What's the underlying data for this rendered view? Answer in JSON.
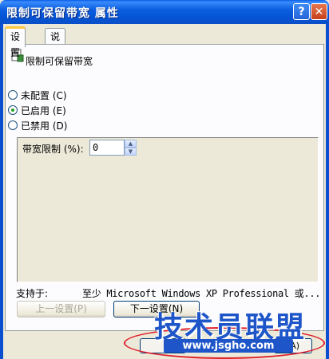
{
  "window": {
    "title": "限制可保留带宽 属性",
    "help": "?",
    "close": "✕"
  },
  "tabs": [
    {
      "label": "设置"
    },
    {
      "label": "说明"
    }
  ],
  "policy_name": "限制可保留带宽",
  "options": [
    {
      "label": "未配置 (C)",
      "checked": false
    },
    {
      "label": "已启用 (E)",
      "checked": true
    },
    {
      "label": "已禁用 (D)",
      "checked": false
    }
  ],
  "bandwidth": {
    "label": "带宽限制 (%):",
    "value": "0"
  },
  "support": {
    "label": "支持于:",
    "text": "至少 Microsoft Windows XP Professional 或..."
  },
  "buttons": {
    "prev": "上一设置(P)",
    "next": "下一设置(N)",
    "apply": "(A)"
  },
  "watermark": {
    "brand": "技术员联盟",
    "url": "www.jsgho.com"
  },
  "colors": {
    "titlebar": "#0a5ee7",
    "accent": "#1e56c9",
    "highlight": "#e0202a"
  }
}
